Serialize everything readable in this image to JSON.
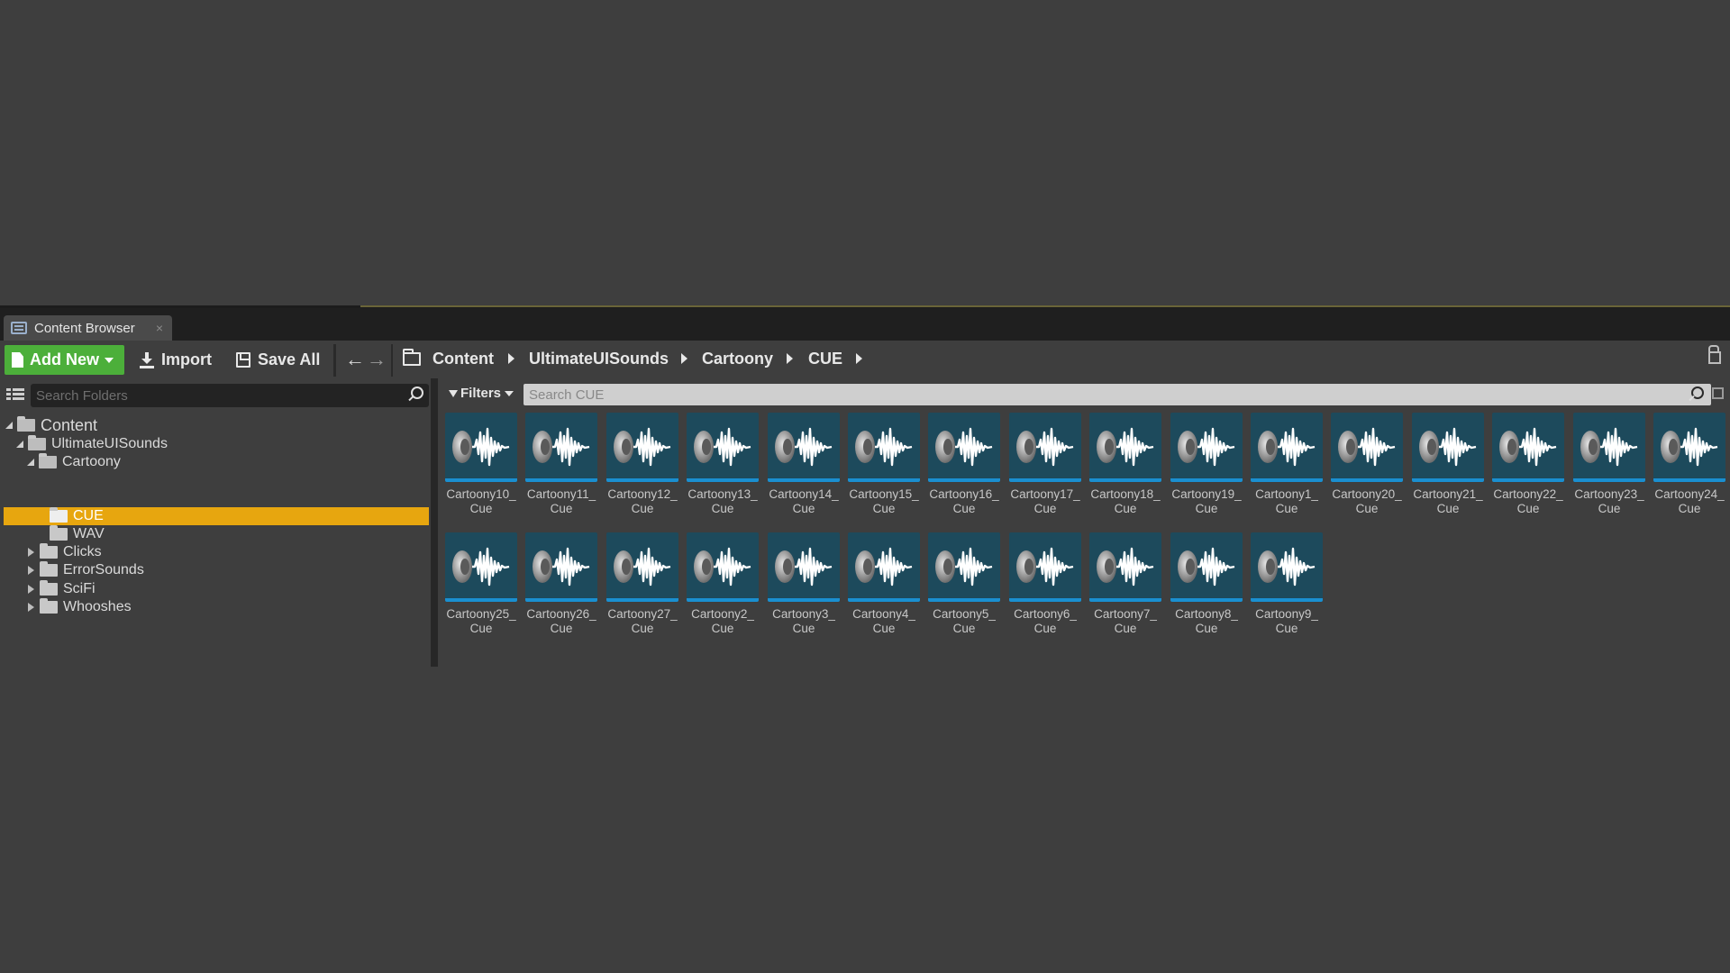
{
  "tab": {
    "title": "Content Browser",
    "close": "×"
  },
  "toolbar": {
    "add_new": "Add New",
    "import": "Import",
    "save_all": "Save All",
    "breadcrumb": [
      "Content",
      "UltimateUISounds",
      "Cartoony",
      "CUE"
    ]
  },
  "sources": {
    "search_placeholder": "Search Folders",
    "tree": [
      {
        "label": "Content",
        "expanded": true,
        "selected": false
      },
      {
        "label": "UltimateUISounds",
        "expanded": true,
        "selected": false
      },
      {
        "label": "Cartoony",
        "expanded": true,
        "selected": false
      },
      {
        "label": "CUE",
        "expanded": false,
        "selected": true
      },
      {
        "label": "WAV",
        "expanded": false,
        "selected": false
      },
      {
        "label": "Clicks",
        "expanded": false,
        "selected": false
      },
      {
        "label": "ErrorSounds",
        "expanded": false,
        "selected": false
      },
      {
        "label": "SciFi",
        "expanded": false,
        "selected": false
      },
      {
        "label": "Whooshes",
        "expanded": false,
        "selected": false
      }
    ]
  },
  "assets": {
    "filters_label": "Filters",
    "search_placeholder": "Search CUE",
    "items": [
      {
        "line1": "Cartoony10_",
        "line2": "Cue"
      },
      {
        "line1": "Cartoony11_",
        "line2": "Cue"
      },
      {
        "line1": "Cartoony12_",
        "line2": "Cue"
      },
      {
        "line1": "Cartoony13_",
        "line2": "Cue"
      },
      {
        "line1": "Cartoony14_",
        "line2": "Cue"
      },
      {
        "line1": "Cartoony15_",
        "line2": "Cue"
      },
      {
        "line1": "Cartoony16_",
        "line2": "Cue"
      },
      {
        "line1": "Cartoony17_",
        "line2": "Cue"
      },
      {
        "line1": "Cartoony18_",
        "line2": "Cue"
      },
      {
        "line1": "Cartoony19_",
        "line2": "Cue"
      },
      {
        "line1": "Cartoony1_",
        "line2": "Cue"
      },
      {
        "line1": "Cartoony20_",
        "line2": "Cue"
      },
      {
        "line1": "Cartoony21_",
        "line2": "Cue"
      },
      {
        "line1": "Cartoony22_",
        "line2": "Cue"
      },
      {
        "line1": "Cartoony23_",
        "line2": "Cue"
      },
      {
        "line1": "Cartoony24_",
        "line2": "Cue"
      },
      {
        "line1": "Cartoony25_",
        "line2": "Cue"
      },
      {
        "line1": "Cartoony26_",
        "line2": "Cue"
      },
      {
        "line1": "Cartoony27_",
        "line2": "Cue"
      },
      {
        "line1": "Cartoony2_",
        "line2": "Cue"
      },
      {
        "line1": "Cartoony3_",
        "line2": "Cue"
      },
      {
        "line1": "Cartoony4_",
        "line2": "Cue"
      },
      {
        "line1": "Cartoony5_",
        "line2": "Cue"
      },
      {
        "line1": "Cartoony6_",
        "line2": "Cue"
      },
      {
        "line1": "Cartoony7_",
        "line2": "Cue"
      },
      {
        "line1": "Cartoony8_",
        "line2": "Cue"
      },
      {
        "line1": "Cartoony9_",
        "line2": "Cue"
      }
    ]
  },
  "icons": {
    "tab": "content-browser-icon",
    "add_new": "new-document-icon",
    "import": "download-icon",
    "save_all": "save-icon",
    "back": "arrow-left-icon",
    "forward": "arrow-right-icon",
    "breadcrumb_root": "folder-icon",
    "lock": "lock-icon",
    "search": "search-icon",
    "asset_thumbnail": "sound-cue-icon"
  },
  "colors": {
    "accent_green": "#4caf3a",
    "selection": "#e7a60f",
    "thumb_bg": "#1d4a5c",
    "thumb_bar": "#1a8fd0"
  }
}
